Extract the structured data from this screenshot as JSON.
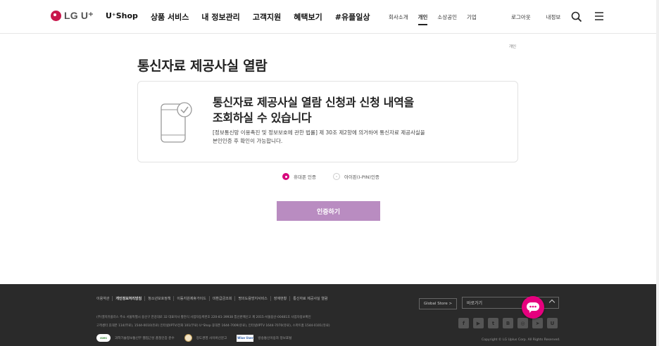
{
  "header": {
    "logo_text": "LG U⁺",
    "gnb": [
      "U⁺Shop",
      "상품 서비스",
      "내 정보관리",
      "고객지원",
      "혜택보기",
      "#유플일상"
    ],
    "sub_nav": [
      "회사소개",
      "개인",
      "소상공인",
      "기업"
    ],
    "sub_nav_active": "개인",
    "util": [
      "로그아웃",
      "내정보"
    ],
    "icons": {
      "search": "search-icon",
      "menu": "hamburger-menu-icon"
    }
  },
  "main": {
    "tiny_label": "개인",
    "title": "통신자료 제공사실 열람",
    "card": {
      "headline_line1": "통신자료 제공사실 열람 신청과 신청 내역을",
      "headline_line2": "조회하실 수 있습니다",
      "desc_line1": "[정보통신망 이용촉진 및 정보보호에 관한 법률] 제 30조 제2항에 의거하여 통신자료 제공사실을",
      "desc_line2": "본인인증 후 확인이 가능합니다.",
      "icon": "phone-check-icon"
    },
    "auth_options": [
      {
        "label": "휴대폰 인증",
        "selected": true
      },
      {
        "label": "아이핀(I-PIN)인증",
        "selected": false
      }
    ],
    "submit_label": "인증하기",
    "accent_color": "#d7097d",
    "button_color": "#b98cc1"
  },
  "footer": {
    "links": [
      "이용약관",
      "개인정보처리방침",
      "청소년보호정책",
      "이동지원제휴가이드",
      "미환급금조회",
      "명의도용방지서비스",
      "장애현황",
      "통신자료 제공사실 열람"
    ],
    "bold_link": "개인정보처리방침",
    "info_line1": "(주)엘지유플러스  주소 서울특별시 용산구 한강대로 32   대표이사 황현식   사업자등록번호 220-81-39938   통신판매신고 제 2015-서울용산-00481호   사업자정보확인",
    "info_line2": "고객센터   휴대폰 114(무료), 1544-0010(유료)   인터넷/IPTV/전화 101(무료)   U⁺Shop 휴대폰 1644-7009(유료), 인터넷/IPTV 1644-7070(유료), 스마트홈 1544-0101(유료)",
    "cert1_badge": "ISMS",
    "cert1_text": "과학기술정보통신부 웹접근성 품질인증 준수",
    "cert2_text": "정도경영 사이버신문고",
    "cert3_badge": "Wise User",
    "cert3_text": "방송통신이용자 정보포털",
    "global_store": "Global Store >",
    "goto_label": "바로가기",
    "social_icons": [
      "facebook-icon",
      "youtube-icon",
      "twitter-icon",
      "blog-icon",
      "instagram-icon",
      "post-icon",
      "app-icon"
    ],
    "social_glyphs": [
      "f",
      "▶",
      "t",
      "B",
      "◎",
      "➤",
      "U"
    ],
    "copyright": "Copyright © LG Uplus Corp. All Rights Reserved."
  },
  "chatbot": {
    "icon": "chatbot-icon"
  }
}
